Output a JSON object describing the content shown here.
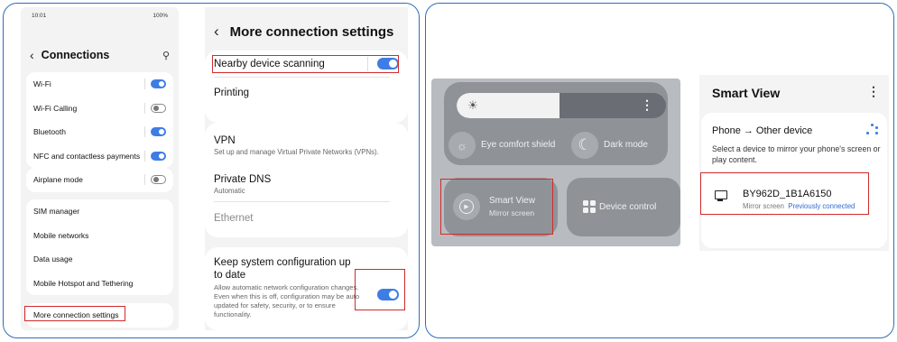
{
  "phone1": {
    "status_time": "10:01",
    "status_right": "100%",
    "title": "Connections",
    "group1": [
      {
        "label": "Wi-Fi",
        "toggle": "on"
      },
      {
        "label": "Wi-Fi Calling",
        "toggle": "off"
      },
      {
        "label": "Bluetooth",
        "toggle": "on"
      },
      {
        "label": "NFC and contactless payments",
        "toggle": "on"
      }
    ],
    "group2": [
      {
        "label": "Airplane mode",
        "toggle": "off"
      }
    ],
    "group3": [
      {
        "label": "SIM manager"
      },
      {
        "label": "Mobile networks"
      },
      {
        "label": "Data usage"
      },
      {
        "label": "Mobile Hotspot and Tethering"
      }
    ],
    "group4": [
      {
        "label": "More connection settings"
      }
    ]
  },
  "phone2": {
    "title": "More connection settings",
    "nearby": {
      "label": "Nearby device scanning",
      "toggle": "on"
    },
    "printing": "Printing",
    "vpn": {
      "label": "VPN",
      "sub": "Set up and manage Virtual Private Networks (VPNs)."
    },
    "dns": {
      "label": "Private DNS",
      "sub": "Automatic"
    },
    "ethernet": "Ethernet",
    "keep": {
      "label": "Keep system configuration up to date",
      "sub": "Allow automatic network configuration changes. Even when this is off, configuration may be auto updated for safety, security, or to ensure functionality.",
      "toggle": "on"
    }
  },
  "quick_panel": {
    "eye_comfort": "Eye comfort shield",
    "dark_mode": "Dark mode",
    "smart_view_title": "Smart View",
    "smart_view_sub": "Mirror screen",
    "device_control": "Device control"
  },
  "smart_view_dialog": {
    "title": "Smart View",
    "mode": "Phone → Other device",
    "description": "Select a device to mirror your phone's screen or play content.",
    "device_name": "BY962D_1B1A6150",
    "device_sub": "Mirror screen",
    "device_status": "Previously connected"
  },
  "colors": {
    "accent": "#3e7de6",
    "highlight": "#d12b2b",
    "panel_border": "#2f6fb5"
  }
}
